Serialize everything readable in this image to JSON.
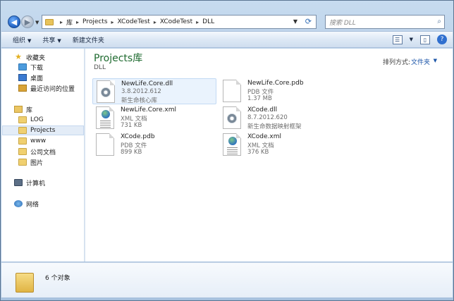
{
  "address": {
    "crumbs": [
      "库",
      "Projects",
      "XCodeTest",
      "XCodeTest",
      "DLL"
    ],
    "search_placeholder": "搜索 DLL"
  },
  "toolbar": {
    "organize": "组织",
    "share": "共享",
    "new_folder": "新建文件夹"
  },
  "nav": {
    "favorites": "收藏夹",
    "downloads": "下载",
    "desktop": "桌面",
    "recent": "最近访问的位置",
    "library": "库",
    "log": "LOG",
    "projects": "Projects",
    "www": "www",
    "company_docs": "公司文档",
    "pictures": "图片",
    "computer": "计算机",
    "network": "网络"
  },
  "content": {
    "title": "Projects库",
    "subtitle": "DLL",
    "arrange_label": "排列方式:",
    "arrange_value": "文件夹",
    "files": [
      {
        "name": "NewLife.Core.dll",
        "meta1": "3.8.2012.612",
        "meta2": "新生命核心库",
        "icon": "dll-gear-icon"
      },
      {
        "name": "NewLife.Core.pdb",
        "meta1": "PDB 文件",
        "meta2": "1.37 MB",
        "icon": "blank-file-icon"
      },
      {
        "name": "NewLife.Core.xml",
        "meta1": "XML 文档",
        "meta2": "731 KB",
        "icon": "xml-file-icon"
      },
      {
        "name": "XCode.dll",
        "meta1": "8.7.2012.620",
        "meta2": "新生命数据映射框架",
        "icon": "dll-gear-icon"
      },
      {
        "name": "XCode.pdb",
        "meta1": "PDB 文件",
        "meta2": "899 KB",
        "icon": "blank-file-icon"
      },
      {
        "name": "XCode.xml",
        "meta1": "XML 文档",
        "meta2": "376 KB",
        "icon": "xml-file-icon"
      }
    ]
  },
  "details": {
    "count": "6 个对象"
  }
}
